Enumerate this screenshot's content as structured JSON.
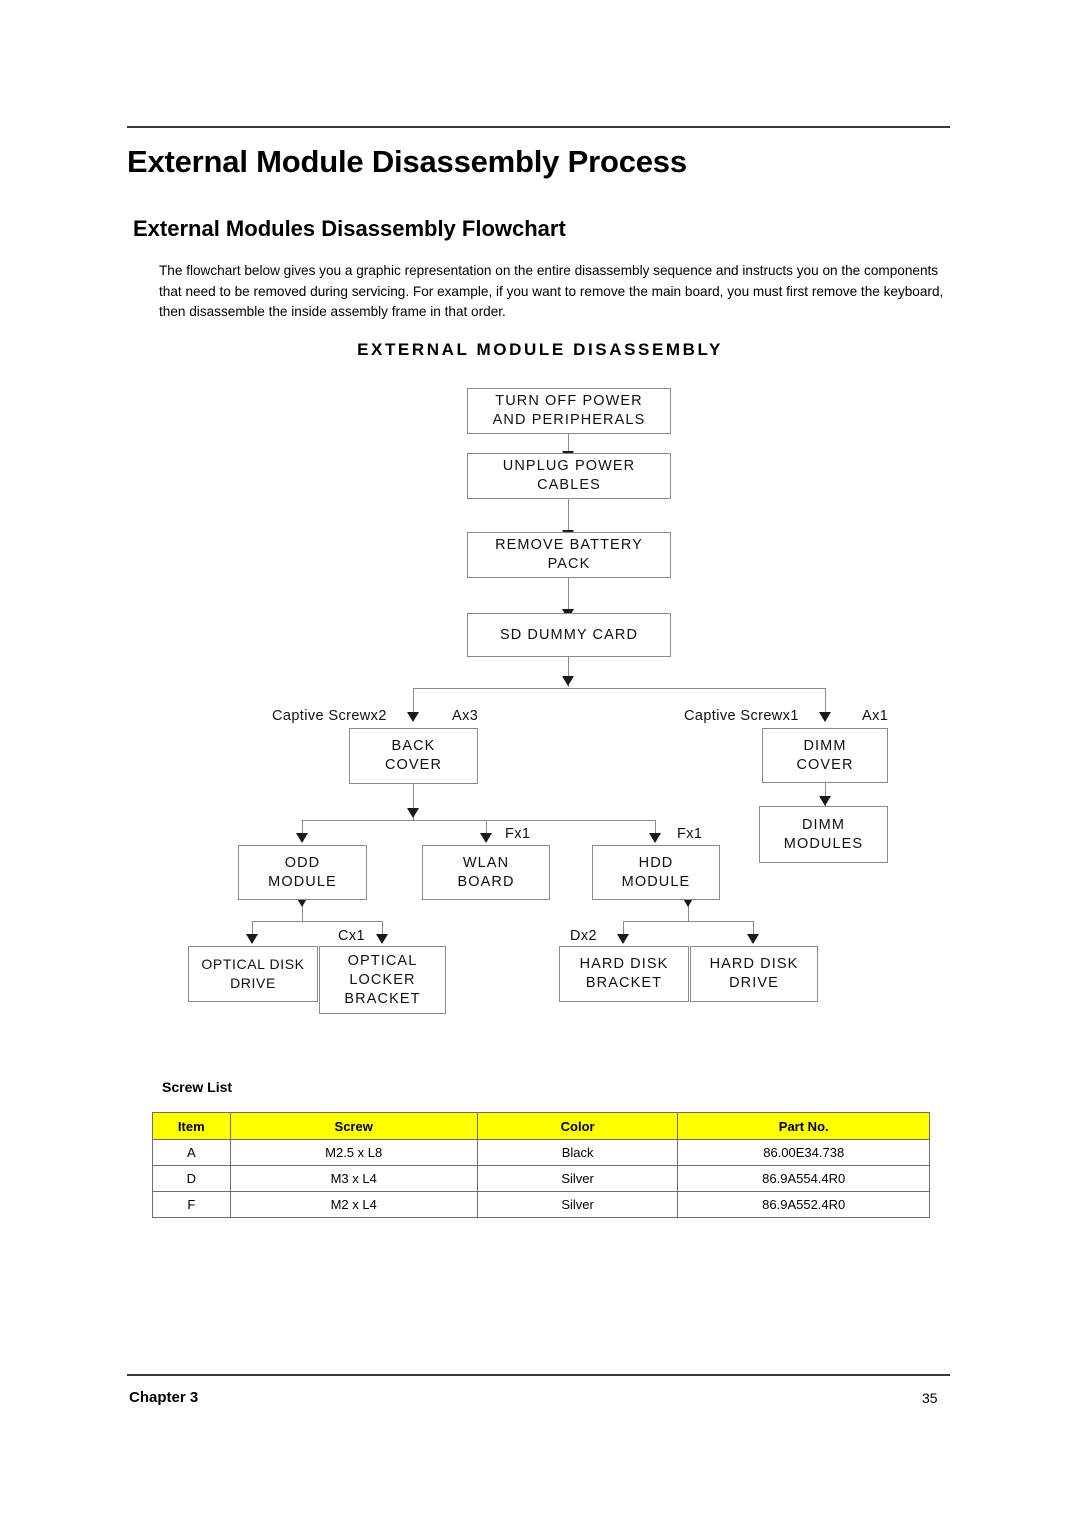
{
  "document": {
    "page_title": "External Module Disassembly Process",
    "section_title": "External Modules Disassembly Flowchart",
    "intro_paragraph": "The flowchart below gives you a graphic representation on the entire disassembly sequence and instructs you on the components that need to be removed during servicing. For example, if you want to remove the main board, you must first remove the keyboard, then disassemble the inside assembly frame in that order."
  },
  "flowchart": {
    "title": "EXTERNAL MODULE DISASSEMBLY",
    "nodes": {
      "turn_off_power": "TURN OFF POWER AND PERIPHERALS",
      "turn_off_power_line1": "TURN OFF POWER",
      "turn_off_power_line2": "AND PERIPHERALS",
      "unplug_power_line1": "UNPLUG POWER",
      "unplug_power_line2": "CABLES",
      "remove_battery_line1": "REMOVE BATTERY",
      "remove_battery_line2": "PACK",
      "sd_dummy_card": "SD DUMMY CARD",
      "back_cover_line1": "BACK",
      "back_cover_line2": "COVER",
      "dimm_cover_line1": "DIMM",
      "dimm_cover_line2": "COVER",
      "dimm_modules_line1": "DIMM",
      "dimm_modules_line2": "MODULES",
      "odd_module_line1": "ODD",
      "odd_module_line2": "MODULE",
      "wlan_board_line1": "WLAN",
      "wlan_board_line2": "BOARD",
      "hdd_module_line1": "HDD",
      "hdd_module_line2": "MODULE",
      "optical_disk_drive_line1": "OPTICAL DISK",
      "optical_disk_drive_line2": "DRIVE",
      "optical_locker_line1": "OPTICAL",
      "optical_locker_line2": "LOCKER",
      "optical_locker_line3": "BRACKET",
      "hard_disk_bracket_line1": "HARD DISK",
      "hard_disk_bracket_line2": "BRACKET",
      "hard_disk_drive_line1": "HARD DISK",
      "hard_disk_drive_line2": "DRIVE"
    },
    "annotations": {
      "captive_screw_x2": "Captive Screwx2",
      "a_x3": "Ax3",
      "captive_screw_x1": "Captive Screwx1",
      "a_x1": "Ax1",
      "f_x1_wlan": "Fx1",
      "f_x1_hdd": "Fx1",
      "c_x1": "Cx1",
      "d_x2": "Dx2"
    }
  },
  "screw_list": {
    "title": "Screw List",
    "header_bg": "#ffff00",
    "columns": [
      "Item",
      "Screw",
      "Color",
      "Part No."
    ],
    "rows": [
      {
        "item": "A",
        "screw": "M2.5 x L8",
        "color": "Black",
        "part_no": "86.00E34.738"
      },
      {
        "item": "D",
        "screw": "M3 x L4",
        "color": "Silver",
        "part_no": "86.9A554.4R0"
      },
      {
        "item": "F",
        "screw": "M2 x L4",
        "color": "Silver",
        "part_no": "86.9A552.4R0"
      }
    ]
  },
  "footer": {
    "chapter": "Chapter 3",
    "page_number": "35"
  }
}
